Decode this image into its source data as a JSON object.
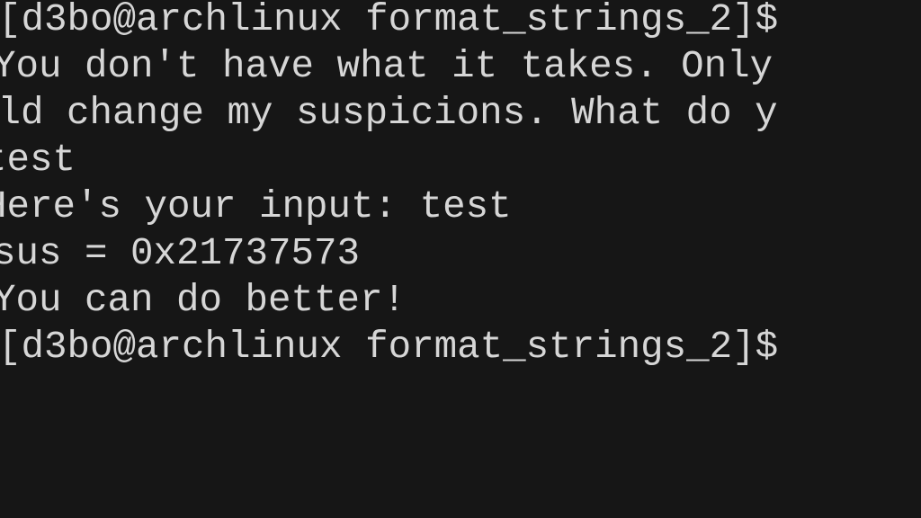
{
  "terminal": {
    "lines": [
      "[d3bo@archlinux format_strings_2]$",
      "You don't have what it takes. Only",
      "uld change my suspicions. What do y",
      "test",
      "Here's your input: test",
      "sus = 0x21737573",
      "You can do better!",
      "[d3bo@archlinux format_strings_2]$"
    ]
  }
}
